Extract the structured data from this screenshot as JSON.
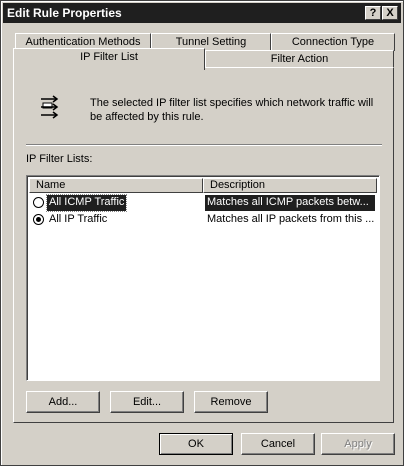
{
  "window": {
    "title": "Edit Rule Properties",
    "help_label": "?",
    "close_label": "X"
  },
  "tabs": {
    "back_row": [
      {
        "label": "Authentication Methods"
      },
      {
        "label": "Tunnel Setting"
      },
      {
        "label": "Connection Type"
      }
    ],
    "front_row": [
      {
        "label": "IP Filter List",
        "active": true
      },
      {
        "label": "Filter Action",
        "active": false
      }
    ]
  },
  "panel": {
    "info_icon": "ip-filter-list-icon",
    "description": "The selected IP filter list specifies which network traffic will be affected by this rule.",
    "lists_label": "IP Filter Lists:",
    "columns": [
      "Name",
      "Description"
    ],
    "rows": [
      {
        "name": "All ICMP Traffic",
        "description": "Matches all ICMP packets betw...",
        "checked": false,
        "selected": true
      },
      {
        "name": "All IP Traffic",
        "description": "Matches all IP packets from this ...",
        "checked": true,
        "selected": false
      }
    ],
    "buttons": {
      "add": "Add...",
      "edit": "Edit...",
      "remove": "Remove"
    }
  },
  "footer": {
    "ok": "OK",
    "cancel": "Cancel",
    "apply": "Apply"
  }
}
